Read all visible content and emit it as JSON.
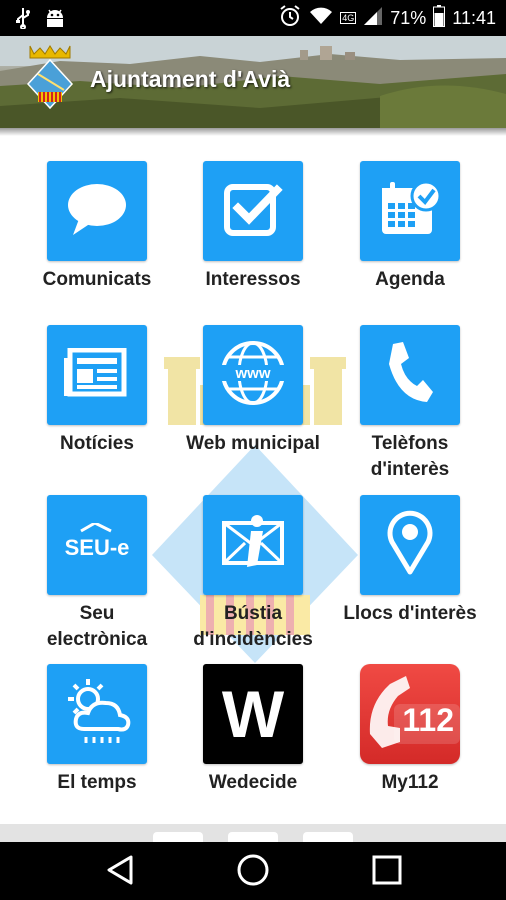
{
  "status_bar": {
    "battery_percent": "71%",
    "time": "11:41",
    "network_label": "4G"
  },
  "header": {
    "title": "Ajuntament d'Avià"
  },
  "tiles": [
    {
      "label": "Comunicats",
      "icon": "chat-bubble-icon"
    },
    {
      "label": "Interessos",
      "icon": "checkbox-icon"
    },
    {
      "label": "Agenda",
      "icon": "calendar-icon"
    },
    {
      "label": "Notícies",
      "icon": "newspaper-icon"
    },
    {
      "label": "Web municipal",
      "icon": "www-globe-icon"
    },
    {
      "label": "Telèfons d'interès",
      "icon": "phone-icon"
    },
    {
      "label": "Seu electrònica",
      "icon": "seu-e-icon"
    },
    {
      "label": "Bústia d'incidències",
      "icon": "mailbox-info-icon"
    },
    {
      "label": "Llocs d'interès",
      "icon": "map-pin-icon"
    },
    {
      "label": "El temps",
      "icon": "weather-icon"
    },
    {
      "label": "Wedecide",
      "icon": "wedecide-logo-icon"
    },
    {
      "label": "My112",
      "icon": "my112-logo-icon"
    }
  ],
  "logo_text": {
    "wedecide_letter": "W",
    "my112_number": "112",
    "seu_e": "SEU-e"
  },
  "colors": {
    "tile_blue": "#1ea0f5",
    "status_bar": "#000000",
    "nav_bar": "#000000",
    "my112_red": "#e4322f"
  }
}
